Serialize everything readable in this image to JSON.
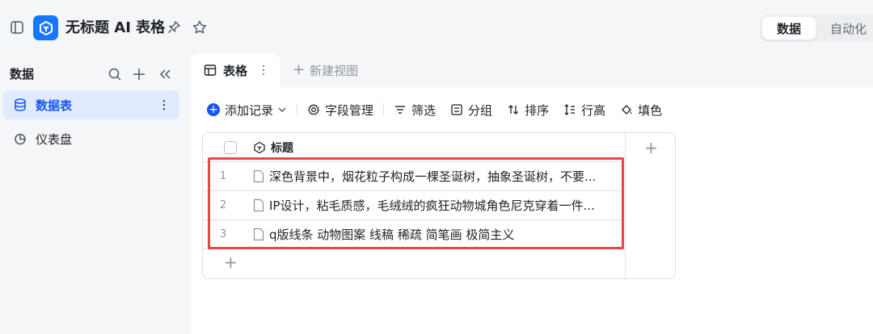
{
  "app": {
    "title": "无标题 AI 表格",
    "logo_icon": "base-logo-icon",
    "brand_color": "#1677ff"
  },
  "header": {
    "modes": [
      {
        "label": "数据",
        "active": true
      },
      {
        "label": "自动化",
        "active": false
      }
    ]
  },
  "sidebar": {
    "title": "数据",
    "items": [
      {
        "label": "数据表",
        "icon": "database-icon",
        "active": true
      },
      {
        "label": "仪表盘",
        "icon": "dashboard-icon",
        "active": false
      }
    ]
  },
  "view_tabs": {
    "active_tab": "表格",
    "new_view_label": "新建视图"
  },
  "toolbar": {
    "add_record": "添加记录",
    "field_manage": "字段管理",
    "filter": "筛选",
    "group": "分组",
    "sort": "排序",
    "row_height": "行高",
    "fill": "填色"
  },
  "table": {
    "primary_field": "标题",
    "rows": [
      {
        "num": "1",
        "title": "深色背景中，烟花粒子构成一棵圣诞树，抽象圣诞树，不要..."
      },
      {
        "num": "2",
        "title": "IP设计，粘毛质感，毛绒绒的疯狂动物城角色尼克穿着一件..."
      },
      {
        "num": "3",
        "title": "q版线条 动物图案 线稿 稀疏 简笔画 极简主义"
      }
    ]
  },
  "highlight_color": "#e8474a",
  "accent_color": "#1456f0"
}
